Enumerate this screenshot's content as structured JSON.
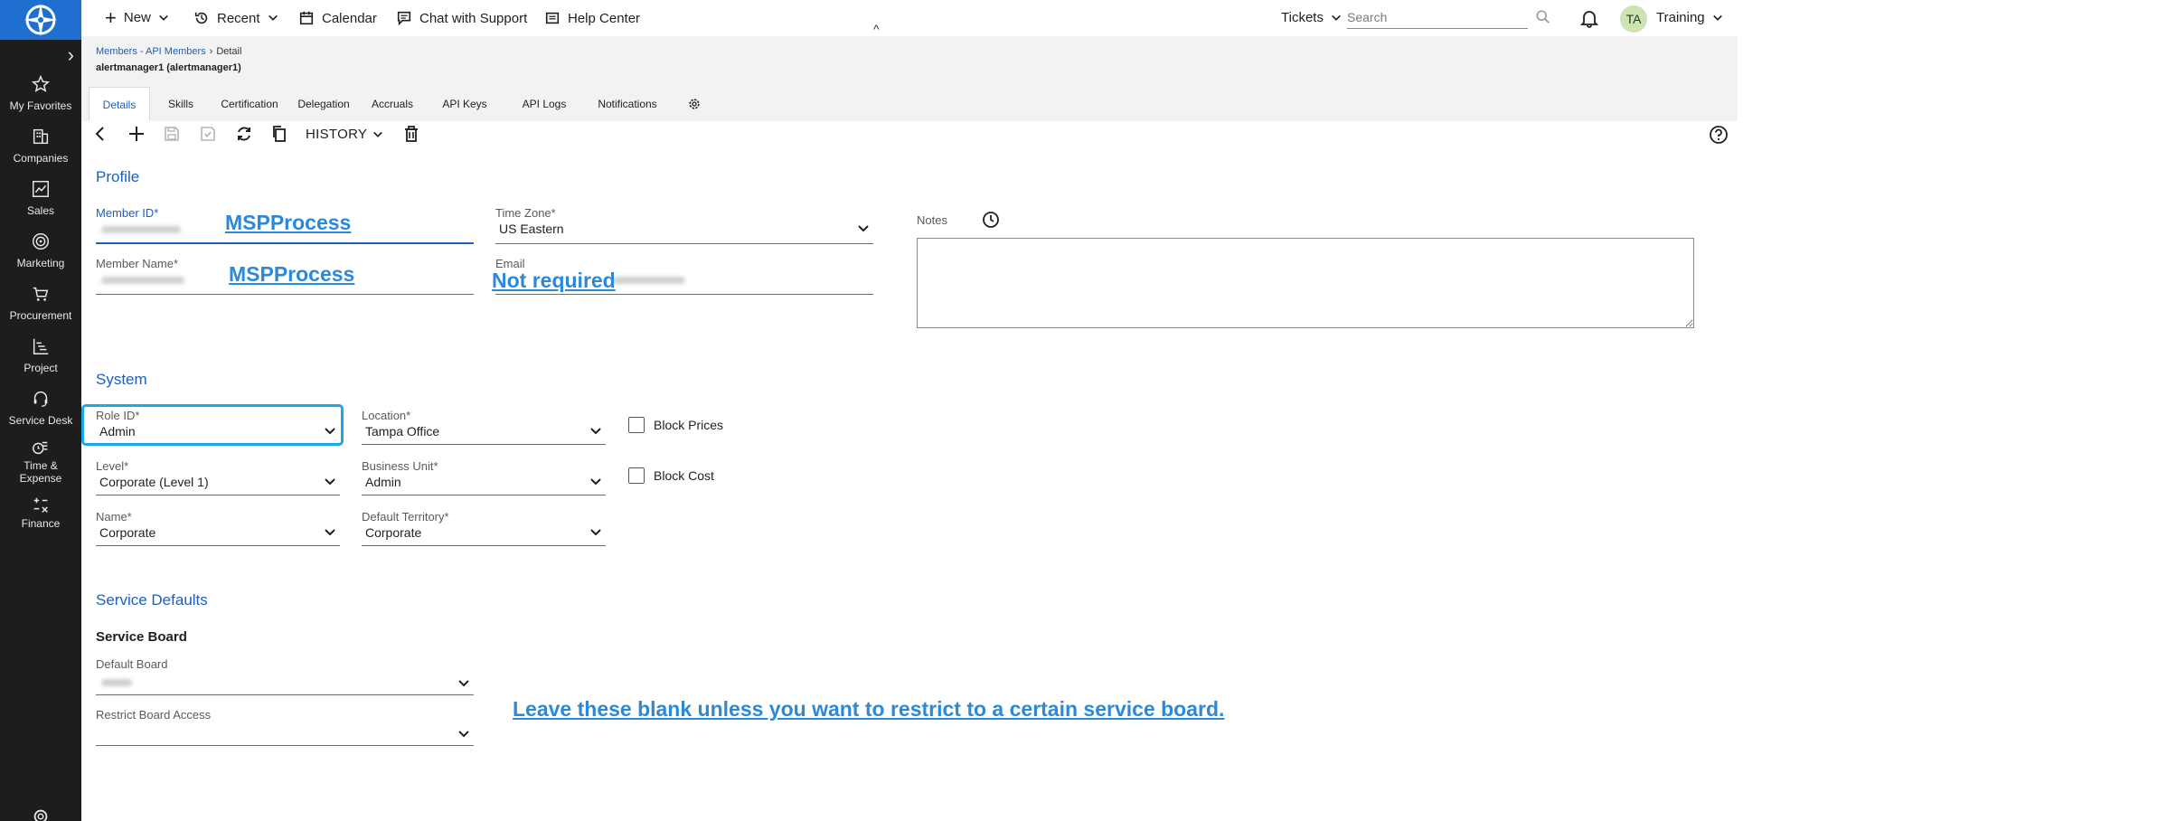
{
  "topbar": {
    "new_label": "New",
    "recent_label": "Recent",
    "calendar_label": "Calendar",
    "chat_label": "Chat with Support",
    "help_label": "Help Center",
    "tickets_label": "Tickets",
    "search_placeholder": "Search",
    "avatar_initials": "TA",
    "user_label": "Training"
  },
  "sidebar": {
    "items": [
      {
        "label": "My Favorites"
      },
      {
        "label": "Companies"
      },
      {
        "label": "Sales"
      },
      {
        "label": "Marketing"
      },
      {
        "label": "Procurement"
      },
      {
        "label": "Project"
      },
      {
        "label": "Service Desk"
      },
      {
        "label": "Time & Expense"
      },
      {
        "label": "Finance"
      }
    ]
  },
  "header": {
    "breadcrumb_parent": "Members - API Members",
    "breadcrumb_current": "Detail",
    "record_title": "alertmanager1 (alertmanager1)",
    "tabs": [
      {
        "label": "Details"
      },
      {
        "label": "Skills"
      },
      {
        "label": "Certification"
      },
      {
        "label": "Delegation"
      },
      {
        "label": "Accruals"
      },
      {
        "label": "API Keys"
      },
      {
        "label": "API Logs"
      },
      {
        "label": "Notifications"
      }
    ]
  },
  "toolbar": {
    "history_label": "HISTORY"
  },
  "profile": {
    "title": "Profile",
    "member_id_label": "Member ID*",
    "member_name_label": "Member Name*",
    "time_zone_label": "Time Zone*",
    "time_zone_value": "US Eastern",
    "email_label": "Email",
    "notes_label": "Notes"
  },
  "system": {
    "title": "System",
    "role_id_label": "Role ID*",
    "role_id_value": "Admin",
    "location_label": "Location*",
    "location_value": "Tampa Office",
    "level_label": "Level*",
    "level_value": "Corporate (Level 1)",
    "business_unit_label": "Business Unit*",
    "business_unit_value": "Admin",
    "name_label": "Name*",
    "name_value": "Corporate",
    "default_territory_label": "Default Territory*",
    "default_territory_value": "Corporate",
    "block_prices_label": "Block Prices",
    "block_cost_label": "Block Cost"
  },
  "service_defaults": {
    "title": "Service Defaults",
    "board_heading": "Service Board",
    "default_board_label": "Default Board",
    "restrict_board_label": "Restrict Board Access"
  },
  "annotations": {
    "member_id_note": "MSPProcess",
    "member_name_note": "MSPProcess",
    "email_note": "Not required",
    "board_note": "Leave these blank unless you want to restrict to a certain service board."
  }
}
